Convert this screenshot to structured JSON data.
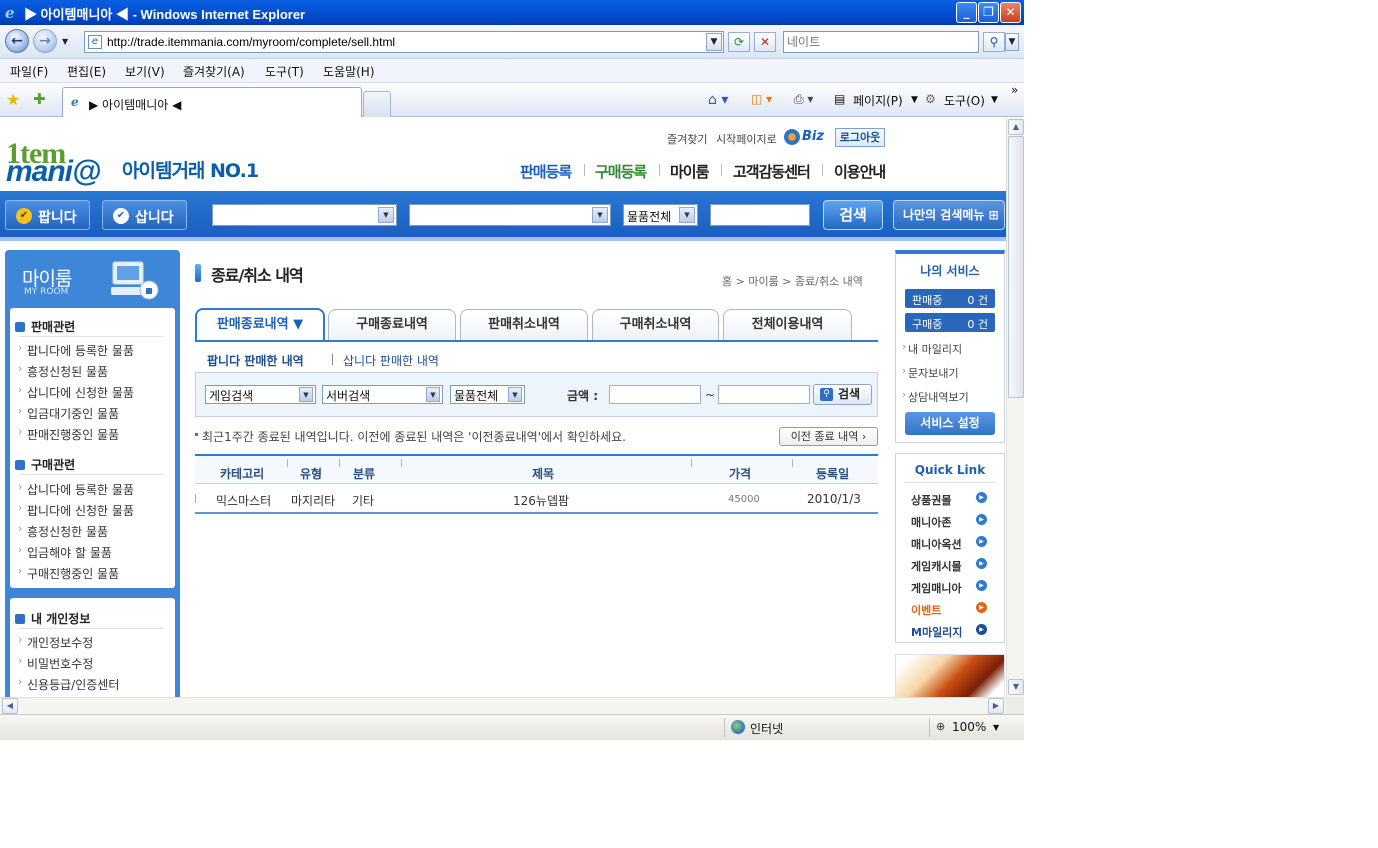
{
  "window": {
    "title": "▶ 아이템매니아 ◀ - Windows Internet Explorer"
  },
  "addressbar": {
    "url": "http://trade.itemmania.com/myroom/complete/sell.html",
    "search_placeholder": "네이트"
  },
  "menubar": {
    "items": [
      "파일(F)",
      "편집(E)",
      "보기(V)",
      "즐겨찾기(A)",
      "도구(T)",
      "도움말(H)"
    ]
  },
  "tabs": {
    "active_label": "▶ 아이템매니아 ◀"
  },
  "commandbar": {
    "page_label": "페이지(P)",
    "tools_label": "도구(O)"
  },
  "statusbar": {
    "zone": "인터넷",
    "zoom": "100%"
  },
  "site": {
    "top_links": [
      "즐겨찾기",
      "시작페이지로"
    ],
    "biz_label": "Biz",
    "logout_label": "로그아웃",
    "logo_line1": "1tem",
    "logo_line2": "mani@",
    "slogan": "아이템거래 NO.1",
    "gnb": [
      "판매등록",
      "구매등록",
      "마이룸",
      "고객감동센터",
      "이용안내"
    ],
    "sell_button": "팝니다",
    "buy_button": "삽니다",
    "search_category": "물품전체",
    "search_button": "검색",
    "my_search_menu": "나만의 검색메뉴 ⊞"
  },
  "leftbar": {
    "title": "마이룸",
    "subtitle": "MY ROOM",
    "sections": [
      {
        "heading": "판매관련",
        "items": [
          "팝니다에 등록한 물품",
          "흥정신청된 물품",
          "삽니다에 신청한 물품",
          "입금대기중인 물품",
          "판매진행중인 물품"
        ]
      },
      {
        "heading": "구매관련",
        "items": [
          "삽니다에 등록한 물품",
          "팝니다에 신청한 물품",
          "흥정신청한 물품",
          "입금해야 할 물품",
          "구매진행중인 물품"
        ]
      },
      {
        "heading": "내 개인정보",
        "items": [
          "개인정보수정",
          "비밀번호수정",
          "신용등급/인증센터"
        ]
      }
    ]
  },
  "main": {
    "title": "종료/취소 내역",
    "breadcrumb": "홈 > 마이룸 > 종료/취소 내역",
    "tabs": [
      "판매종료내역 ▼",
      "구매종료내역",
      "판매취소내역",
      "구매취소내역",
      "전체이용내역"
    ],
    "subtabs": [
      "팝니다 판매한 내역",
      "삽니다 판매한 내역"
    ],
    "filter": {
      "game": "게임검색",
      "server": "서버검색",
      "category": "물품전체",
      "amount_label": "금액 :",
      "tilde": "~",
      "search_button": "검색"
    },
    "notice": "최근1주간 종료된 내역입니다. 이전에 종료된 내역은 '이전종료내역'에서 확인하세요.",
    "prev_button": "이전 종료 내역 ›",
    "table": {
      "headers": [
        "카테고리",
        "유형",
        "분류",
        "제목",
        "가격",
        "등록일"
      ],
      "rows": [
        [
          "믹스마스터",
          "마지리타",
          "기타",
          "126뉴뎁팜",
          "45000",
          "2010/1/3"
        ]
      ]
    }
  },
  "rightbar": {
    "title": "나의 서비스",
    "selling_label": "판매중",
    "selling_count": "0 건",
    "buying_label": "구매중",
    "buying_count": "0 건",
    "links": [
      "내 마일리지",
      "문자보내기",
      "상담내역보기"
    ],
    "settings_button": "서비스 설정",
    "quick_title": "Quick Link",
    "quick_links": [
      "상품권몰",
      "매니아존",
      "매니아옥션",
      "게임캐시몰",
      "게임매니아",
      "이벤트",
      "M마일리지"
    ]
  },
  "colors": {
    "brand_blue": "#1a5fbf",
    "event_orange": "#e0661a"
  }
}
